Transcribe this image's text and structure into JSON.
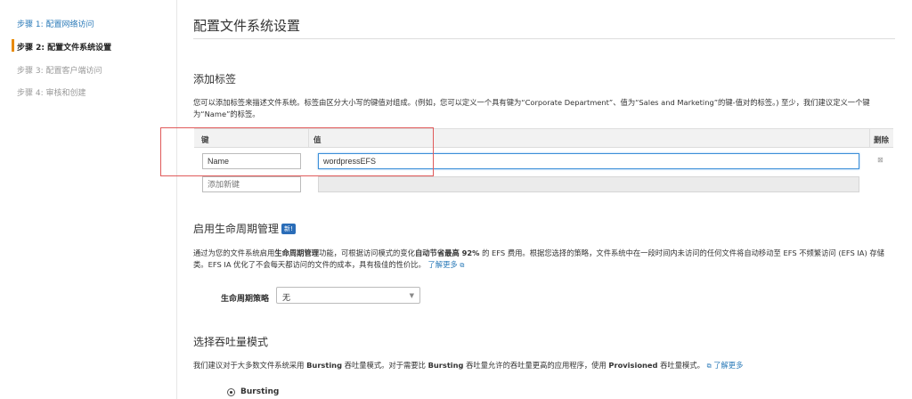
{
  "sidebar": {
    "steps": [
      {
        "label": "步骤 1: 配置网络访问"
      },
      {
        "label": "步骤 2: 配置文件系统设置"
      },
      {
        "label": "步骤 3: 配置客户端访问"
      },
      {
        "label": "步骤 4: 审核和创建"
      }
    ]
  },
  "page": {
    "title": "配置文件系统设置"
  },
  "tags": {
    "heading": "添加标签",
    "desc": "您可以添加标签来描述文件系统。标签由区分大小写的键值对组成。(例如，您可以定义一个具有键为“Corporate Department”、值为“Sales and Marketing”的键-值对的标签。) 至少，我们建议定义一个键为“Name”的标签。",
    "col_key": "键",
    "col_value": "值",
    "col_delete": "删除",
    "rows": [
      {
        "key": "Name",
        "value": "wordpressEFS"
      }
    ],
    "new_key_placeholder": "添加新键"
  },
  "lifecycle": {
    "heading": "启用生命周期管理",
    "badge": "新!",
    "desc_1": "通过为您的文件系统启用",
    "desc_b1": "生命周期管理",
    "desc_2": "功能，可根据访问模式的变化",
    "desc_b2": "自动节省最高 92%",
    "desc_3": " 的 EFS 费用。根据您选择的策略，文件系统中在一段时间内未访问的任何文件将自动移动至 EFS 不频繁访问 (EFS IA) 存储类。EFS IA 优化了不会每天都访问的文件的成本，具有极佳的性价比。",
    "learn_more": "了解更多",
    "policy_label": "生命周期策略",
    "policy_value": "无"
  },
  "throughput": {
    "heading": "选择吞吐量模式",
    "desc_1": "我们建议对于大多数文件系统采用 ",
    "desc_b1": "Bursting",
    "desc_2": " 吞吐量模式。对于需要比 ",
    "desc_b2": "Bursting",
    "desc_3": " 吞吐量允许的吞吐量更高的应用程序，使用 ",
    "desc_b3": "Provisioned",
    "desc_4": " 吞吐量模式。",
    "learn_more": "了解更多",
    "option_bursting": "Bursting"
  }
}
